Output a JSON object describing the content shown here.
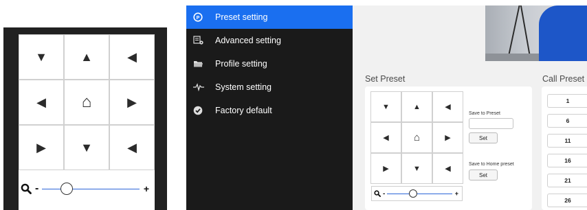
{
  "ptz_pad": {
    "arrows": {
      "up_left": "▼",
      "up": "▲",
      "up_right": "◀",
      "left": "◀",
      "home": "⌂",
      "right": "▶",
      "down_left": "▶",
      "down": "▼",
      "down_right": "◀"
    },
    "zoom": {
      "minus": "-",
      "plus": "+",
      "level": 0.25
    }
  },
  "sidebar": {
    "items": [
      {
        "label": "Preset setting",
        "icon": "preset-icon",
        "active": true
      },
      {
        "label": "Advanced setting",
        "icon": "advanced-settings-icon",
        "active": false
      },
      {
        "label": "Profile setting",
        "icon": "folder-icon",
        "active": false
      },
      {
        "label": "System setting",
        "icon": "pulse-icon",
        "active": false
      },
      {
        "label": "Factory default",
        "icon": "checkmark-icon",
        "active": false
      }
    ]
  },
  "main": {
    "set_preset": {
      "title": "Set Preset",
      "save_to_preset_label": "Save to Preset",
      "preset_input_value": "",
      "set_button": "Set",
      "save_to_home_label": "Save to Home preset",
      "home_set_button": "Set",
      "zoom_level": 0.4
    },
    "call_preset": {
      "title": "Call Preset",
      "presets": [
        "1",
        "6",
        "11",
        "16",
        "21",
        "26"
      ]
    }
  },
  "colors": {
    "accent": "#1a6ff0",
    "sidebar_bg": "#1a1a1a",
    "left_panel_bg": "#212121",
    "slider": "#2a64d8"
  }
}
